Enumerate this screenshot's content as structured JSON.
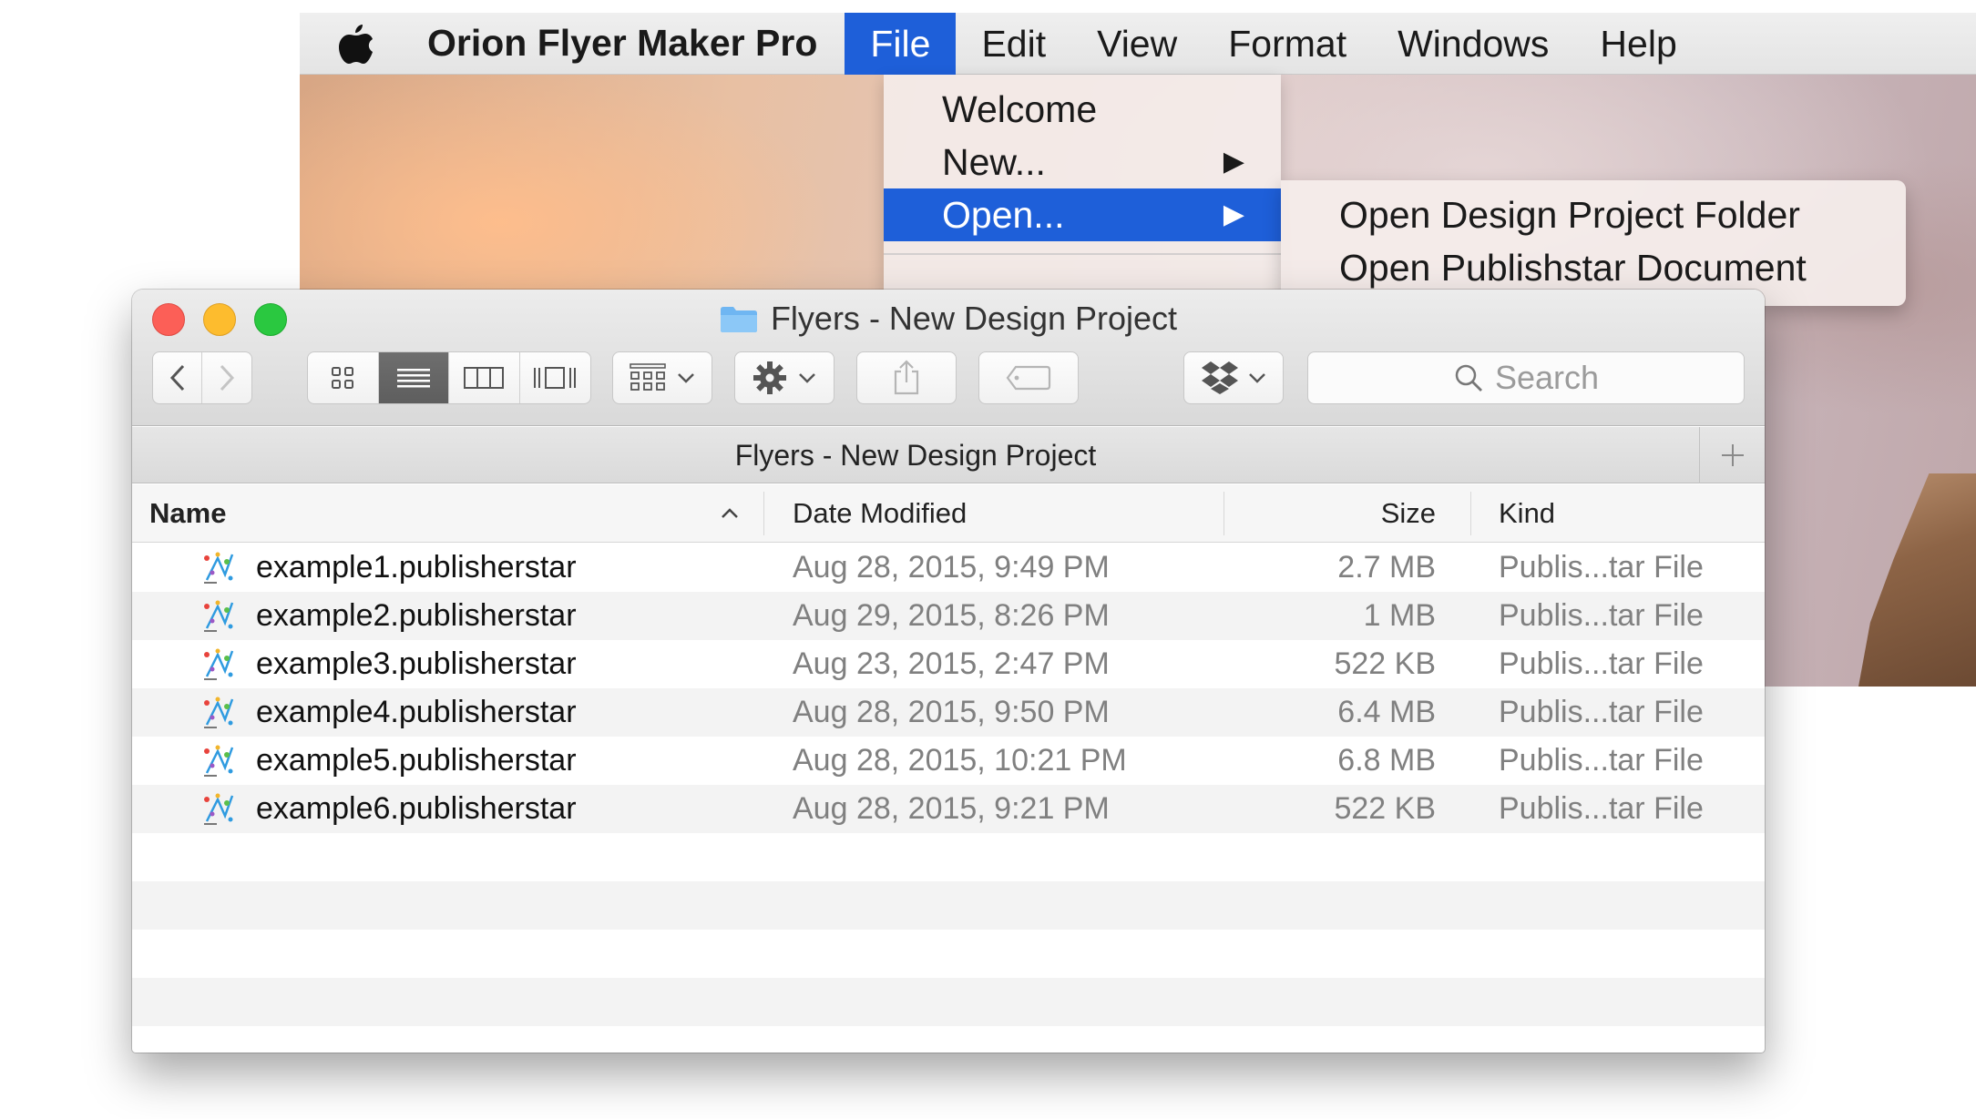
{
  "menubar": {
    "app_name": "Orion Flyer Maker Pro",
    "menus": [
      "File",
      "Edit",
      "View",
      "Format",
      "Windows",
      "Help"
    ]
  },
  "file_menu": {
    "items": [
      {
        "label": "Welcome",
        "submenu": false
      },
      {
        "label": "New...",
        "submenu": true
      },
      {
        "label": "Open...",
        "submenu": true,
        "selected": true
      }
    ],
    "open_submenu": [
      "Open Design Project Folder",
      "Open Publishstar Document"
    ]
  },
  "window": {
    "title": "Flyers - New Design Project",
    "path_title": "Flyers - New Design Project",
    "search_placeholder": "Search"
  },
  "columns": {
    "name": "Name",
    "date": "Date Modified",
    "size": "Size",
    "kind": "Kind"
  },
  "files": [
    {
      "name": "example1.publisherstar",
      "date": "Aug 28, 2015, 9:49 PM",
      "size": "2.7 MB",
      "kind": "Publis...tar File"
    },
    {
      "name": "example2.publisherstar",
      "date": "Aug 29, 2015, 8:26 PM",
      "size": "1 MB",
      "kind": "Publis...tar File"
    },
    {
      "name": "example3.publisherstar",
      "date": "Aug 23, 2015, 2:47 PM",
      "size": "522 KB",
      "kind": "Publis...tar File"
    },
    {
      "name": "example4.publisherstar",
      "date": "Aug 28, 2015, 9:50 PM",
      "size": "6.4 MB",
      "kind": "Publis...tar File"
    },
    {
      "name": "example5.publisherstar",
      "date": "Aug 28, 2015, 10:21 PM",
      "size": "6.8 MB",
      "kind": "Publis...tar File"
    },
    {
      "name": "example6.publisherstar",
      "date": "Aug 28, 2015, 9:21 PM",
      "size": "522 KB",
      "kind": "Publis...tar File"
    }
  ],
  "colors": {
    "selection": "#1e5fd9",
    "close": "#fc5f57",
    "minimize": "#fdbc2e",
    "zoom": "#2ac840"
  },
  "icons": [
    "apple-icon",
    "folder-icon",
    "back-icon",
    "forward-icon",
    "icon-view-icon",
    "list-view-icon",
    "column-view-icon",
    "cover-flow-icon",
    "arrange-icon",
    "gear-icon",
    "share-icon",
    "tag-icon",
    "dropbox-icon",
    "search-icon",
    "sort-ascending-icon",
    "publisherstar-file-icon",
    "add-tab-icon",
    "submenu-arrow-icon"
  ]
}
